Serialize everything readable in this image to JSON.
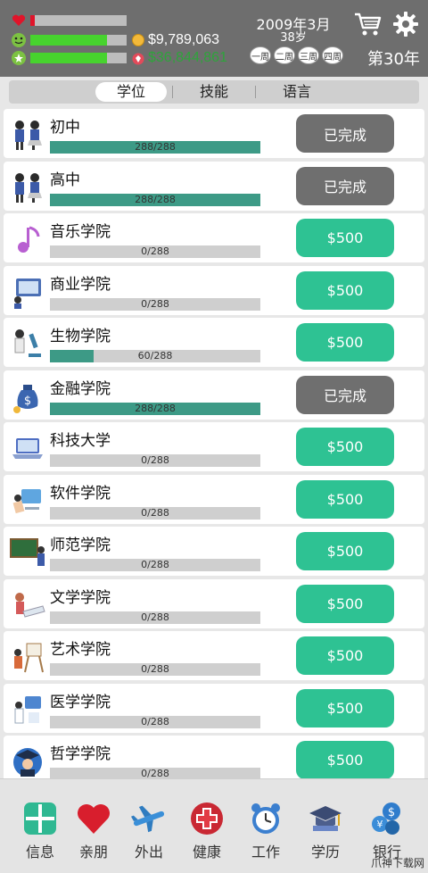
{
  "header": {
    "money": "$9,789,063",
    "money_secondary": "$36,844,861",
    "date": "2009年3月",
    "age": "38岁",
    "weeks": [
      "一周",
      "二周",
      "三周",
      "四周"
    ],
    "year_label": "第30年",
    "stats": {
      "health": 0.05,
      "happiness": 0.8,
      "energy": 0.8
    },
    "colors": {
      "health": "#e0142a",
      "happiness": "#47d32e",
      "energy": "#47d32e"
    }
  },
  "tabs": [
    "学位",
    "技能",
    "语言"
  ],
  "active_tab": 0,
  "degrees": [
    {
      "name": "初中",
      "progress": "288/288",
      "fraction": 1.0,
      "button": "已完成",
      "state": "done",
      "icon": "students-icon"
    },
    {
      "name": "高中",
      "progress": "288/288",
      "fraction": 1.0,
      "button": "已完成",
      "state": "done",
      "icon": "students-icon"
    },
    {
      "name": "音乐学院",
      "progress": "0/288",
      "fraction": 0.0,
      "button": "$500",
      "state": "buy",
      "icon": "music-note-icon"
    },
    {
      "name": "商业学院",
      "progress": "0/288",
      "fraction": 0.0,
      "button": "$500",
      "state": "buy",
      "icon": "business-icon"
    },
    {
      "name": "生物学院",
      "progress": "60/288",
      "fraction": 0.208,
      "button": "$500",
      "state": "buy",
      "icon": "microscope-icon"
    },
    {
      "name": "金融学院",
      "progress": "288/288",
      "fraction": 1.0,
      "button": "已完成",
      "state": "done",
      "icon": "money-bag-icon"
    },
    {
      "name": "科技大学",
      "progress": "0/288",
      "fraction": 0.0,
      "button": "$500",
      "state": "buy",
      "icon": "laptop-icon"
    },
    {
      "name": "软件学院",
      "progress": "0/288",
      "fraction": 0.0,
      "button": "$500",
      "state": "buy",
      "icon": "software-icon"
    },
    {
      "name": "师范学院",
      "progress": "0/288",
      "fraction": 0.0,
      "button": "$500",
      "state": "buy",
      "icon": "blackboard-icon"
    },
    {
      "name": "文学学院",
      "progress": "0/288",
      "fraction": 0.0,
      "button": "$500",
      "state": "buy",
      "icon": "book-icon"
    },
    {
      "name": "艺术学院",
      "progress": "0/288",
      "fraction": 0.0,
      "button": "$500",
      "state": "buy",
      "icon": "easel-icon"
    },
    {
      "name": "医学学院",
      "progress": "0/288",
      "fraction": 0.0,
      "button": "$500",
      "state": "buy",
      "icon": "medicine-icon"
    },
    {
      "name": "哲学学院",
      "progress": "0/288",
      "fraction": 0.0,
      "button": "$500",
      "state": "buy",
      "icon": "graduate-icon"
    }
  ],
  "nav": [
    {
      "label": "信息",
      "icon": "info-grid-icon"
    },
    {
      "label": "亲朋",
      "icon": "heart-icon"
    },
    {
      "label": "外出",
      "icon": "airplane-icon"
    },
    {
      "label": "健康",
      "icon": "red-cross-icon"
    },
    {
      "label": "工作",
      "icon": "alarm-clock-icon"
    },
    {
      "label": "学历",
      "icon": "graduation-cap-icon"
    },
    {
      "label": "银行",
      "icon": "bank-coins-icon"
    }
  ],
  "watermark": "爪神下载网"
}
